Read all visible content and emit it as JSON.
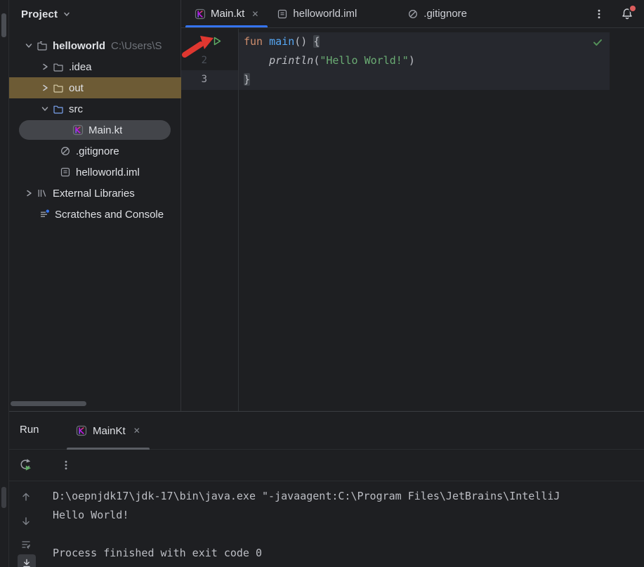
{
  "colors": {
    "background": "#1e1f22",
    "accent_blue": "#3574f0",
    "selection_gray": "#43454a",
    "out_row_highlight": "#6d5b35",
    "keyword_orange": "#cf8e6d",
    "function_blue": "#56a8f5",
    "string_green": "#6aab73",
    "run_green": "#5fad65",
    "check_green": "#549159",
    "notification_red": "#db5c5c",
    "annotation_arrow_red": "#df3730"
  },
  "project_panel": {
    "title": "Project",
    "items": {
      "root_label": "helloworld",
      "root_path": "C:\\Users\\S",
      "idea": ".idea",
      "out": "out",
      "src": "src",
      "main_kt": "Main.kt",
      "gitignore": ".gitignore",
      "iml": "helloworld.iml",
      "external_libraries": "External Libraries",
      "scratches": "Scratches and Console"
    }
  },
  "editor_tabs": {
    "tab1": "Main.kt",
    "tab2": "helloworld.iml",
    "tab3": ".gitignore",
    "close": "✕"
  },
  "editor": {
    "line_numbers": {
      "l1": "1",
      "l2": "2",
      "l3": "3"
    },
    "code": {
      "l1_kw": "fun ",
      "l1_fn": "main",
      "l1_parens": "() ",
      "l1_brace": "{",
      "l2_indent": "    ",
      "l2_fn": "println",
      "l2_open": "(",
      "l2_str": "\"Hello World!\"",
      "l2_close": ")",
      "l3_brace": "}"
    }
  },
  "run_panel": {
    "title": "Run",
    "tab": "MainKt",
    "close": "✕",
    "console": {
      "line1": "D:\\oepnjdk17\\jdk-17\\bin\\java.exe \"-javaagent:C:\\Program Files\\JetBrains\\IntelliJ",
      "line2": "Hello World!",
      "line3": "",
      "line4": "Process finished with exit code 0"
    }
  }
}
